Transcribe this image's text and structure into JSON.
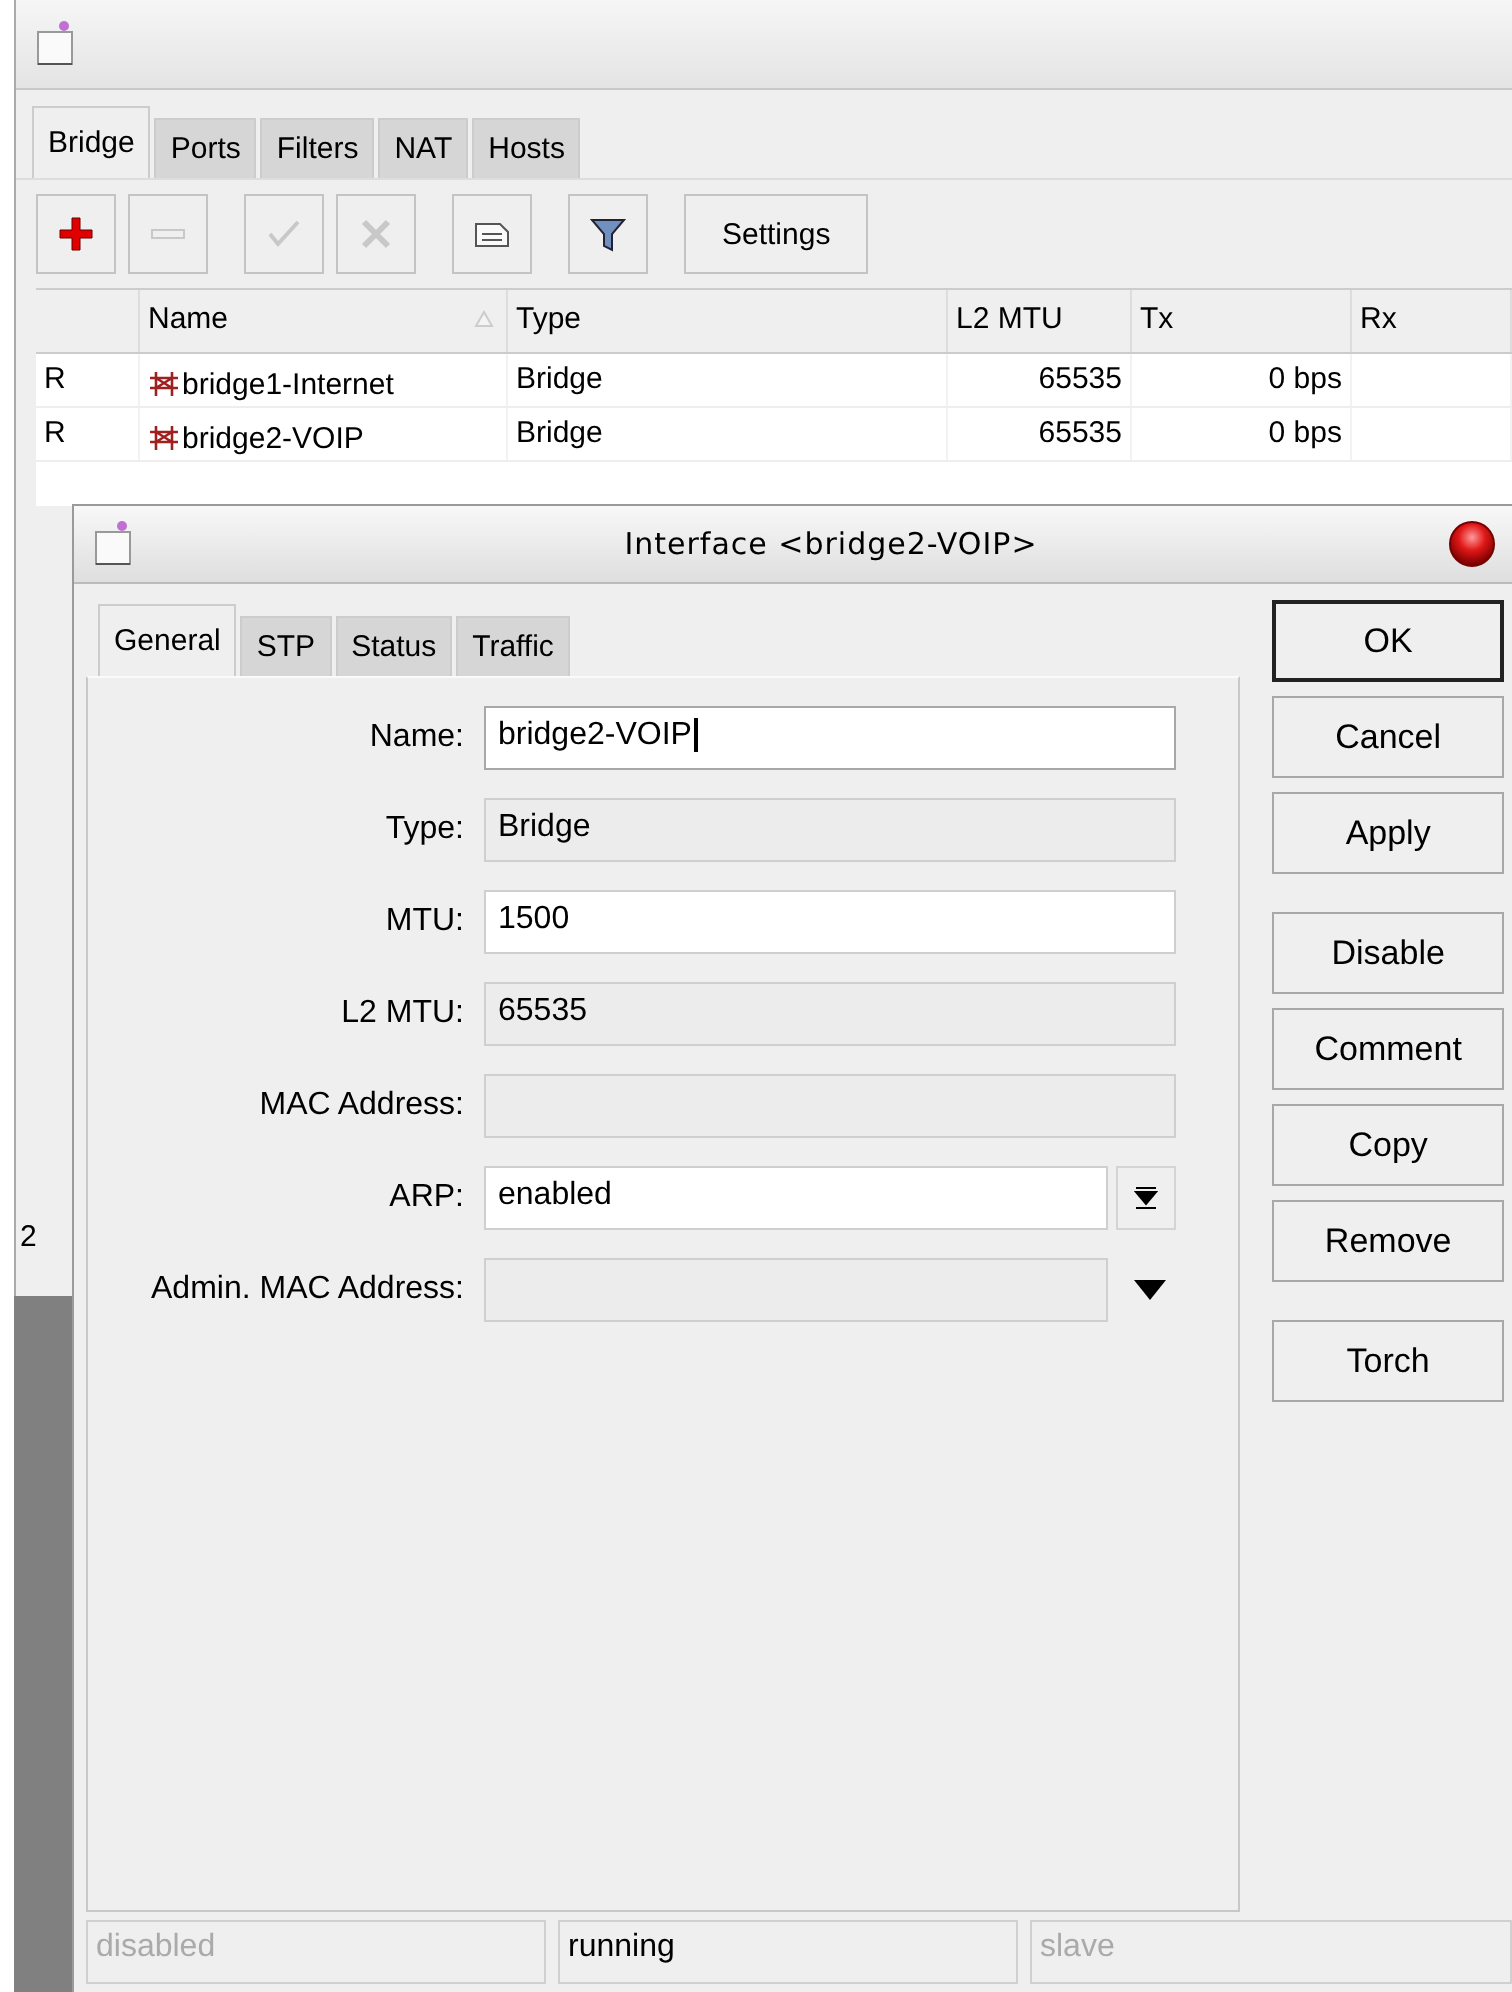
{
  "back_window": {
    "tabs": [
      {
        "label": "Bridge",
        "selected": true
      },
      {
        "label": "Ports",
        "selected": false
      },
      {
        "label": "Filters",
        "selected": false
      },
      {
        "label": "NAT",
        "selected": false
      },
      {
        "label": "Hosts",
        "selected": false
      }
    ],
    "toolbar": [
      {
        "kind": "add",
        "disabled": false
      },
      {
        "kind": "remove",
        "disabled": true
      },
      {
        "kind": "enable",
        "disabled": true
      },
      {
        "kind": "disable",
        "disabled": true
      },
      {
        "kind": "comment",
        "disabled": false
      },
      {
        "kind": "filter",
        "disabled": false
      },
      {
        "kind": "text",
        "label": "Settings",
        "disabled": false
      }
    ],
    "table": {
      "columns": [
        {
          "label": "Name",
          "sorted": true
        },
        {
          "label": "Type",
          "sorted": false
        },
        {
          "label": "L2 MTU",
          "sorted": false
        },
        {
          "label": "Tx",
          "sorted": false
        },
        {
          "label": "Rx",
          "sorted": false
        }
      ],
      "rows": [
        {
          "flag": "R",
          "name": "bridge1-Internet",
          "type": "Bridge",
          "l2_mtu": "65535",
          "tx": "0 bps"
        },
        {
          "flag": "R",
          "name": "bridge2-VOIP",
          "type": "Bridge",
          "l2_mtu": "65535",
          "tx": "0 bps"
        }
      ]
    },
    "status_count": "2"
  },
  "dialog": {
    "title": "Interface <bridge2-VOIP>",
    "tabs": [
      {
        "label": "General",
        "selected": true
      },
      {
        "label": "STP",
        "selected": false
      },
      {
        "label": "Status",
        "selected": false
      },
      {
        "label": "Traffic",
        "selected": false
      }
    ],
    "fields": [
      {
        "label": "Name:",
        "value": "bridge2-VOIP",
        "kind": "text",
        "focused": true
      },
      {
        "label": "Type:",
        "value": "Bridge",
        "kind": "readonly"
      },
      {
        "label": "MTU:",
        "value": "1500",
        "kind": "text",
        "focused": false
      },
      {
        "label": "L2 MTU:",
        "value": "65535",
        "kind": "readonly"
      },
      {
        "label": "MAC Address:",
        "kind": "readonly"
      },
      {
        "label": "ARP:",
        "value": "enabled",
        "kind": "dropdown"
      },
      {
        "label": "Admin. MAC Address:",
        "kind": "readonly-dropdown"
      }
    ],
    "buttons": [
      {
        "label": "OK",
        "default": true
      },
      {
        "label": "Cancel",
        "default": false
      },
      {
        "label": "Apply",
        "default": false
      },
      {
        "label": "Disable",
        "default": false
      },
      {
        "label": "Comment",
        "default": false
      },
      {
        "label": "Copy",
        "default": false
      },
      {
        "label": "Remove",
        "default": false
      },
      {
        "label": "Torch",
        "default": false
      }
    ],
    "status_bar": [
      {
        "text": "disabled",
        "active": false
      },
      {
        "text": "running",
        "active": true
      },
      {
        "text": "slave",
        "active": false
      }
    ]
  }
}
